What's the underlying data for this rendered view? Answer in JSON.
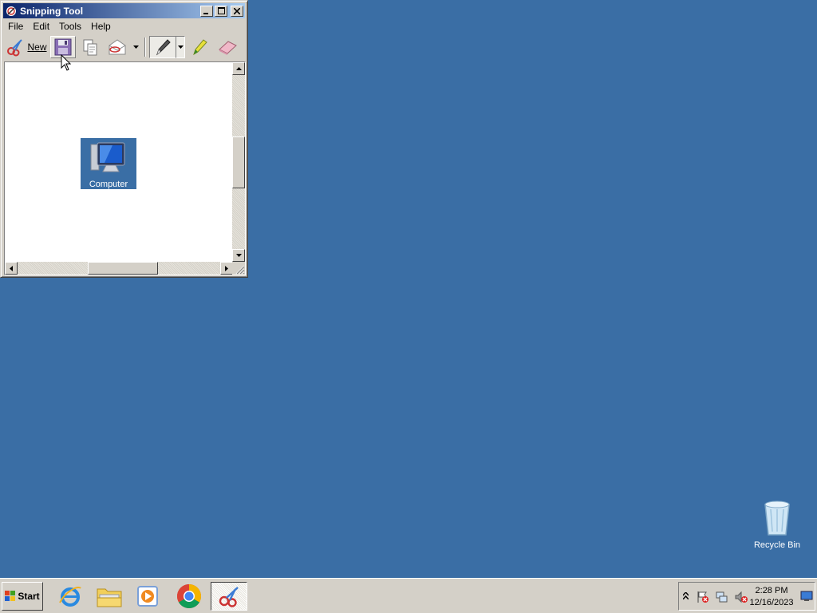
{
  "window": {
    "title": "Snipping Tool",
    "menu": [
      "File",
      "Edit",
      "Tools",
      "Help"
    ],
    "toolbar": {
      "new_label": "New"
    }
  },
  "snip": {
    "icon_label": "Computer"
  },
  "desktop": {
    "recycle_bin_label": "Recycle Bin"
  },
  "taskbar": {
    "start_label": "Start",
    "clock_time": "2:28 PM",
    "clock_date": "12/16/2023"
  },
  "colors": {
    "desktop": "#3a6ea5",
    "chrome": "#d4d0c8",
    "title_start": "#0a246a",
    "title_end": "#a6caf0"
  }
}
